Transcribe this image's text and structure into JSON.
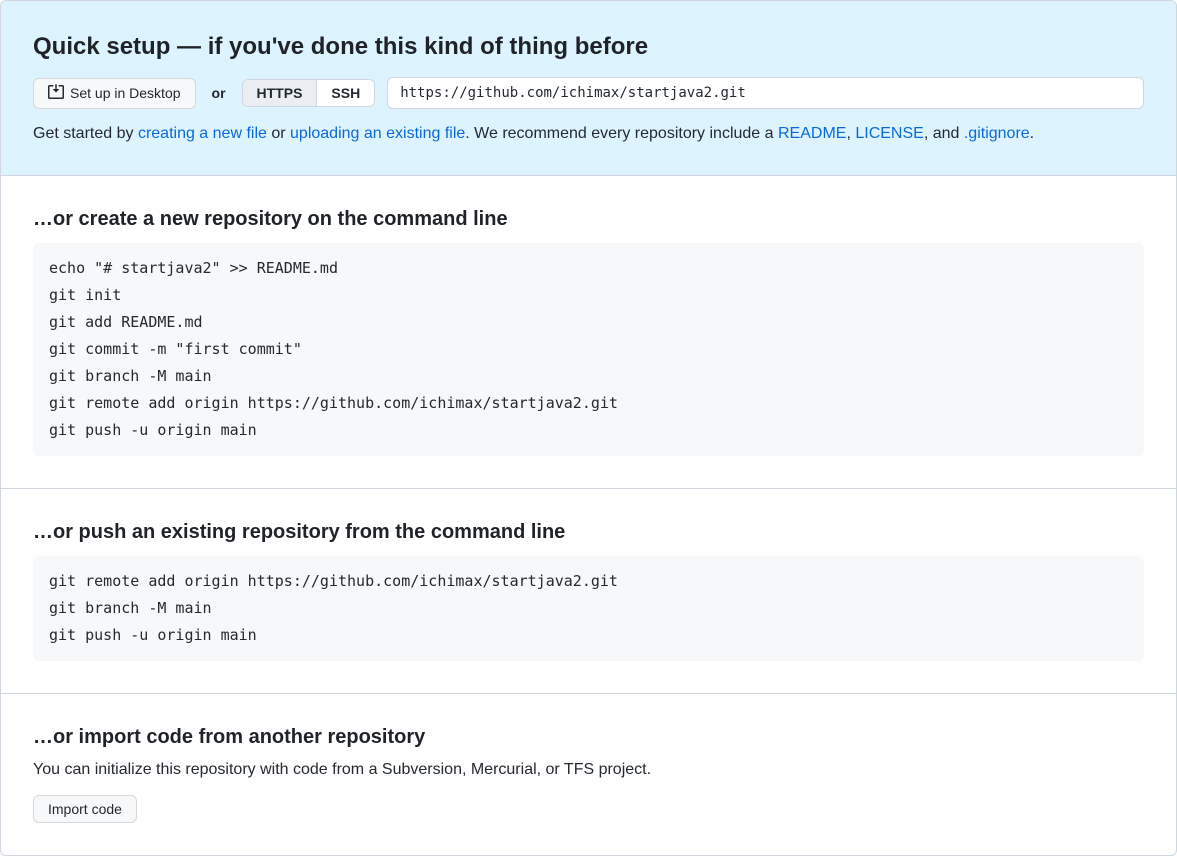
{
  "quickSetup": {
    "heading": "Quick setup — if you've done this kind of thing before",
    "desktopButton": "Set up in Desktop",
    "orLabel": "or",
    "tabs": {
      "https": "HTTPS",
      "ssh": "SSH"
    },
    "cloneUrl": "https://github.com/ichimax/startjava2.git",
    "help": {
      "prefix": "Get started by ",
      "createLink": "creating a new file",
      "mid1": " or ",
      "uploadLink": "uploading an existing file",
      "mid2": ". We recommend every repository include a ",
      "readmeLink": "README",
      "comma": ", ",
      "licenseLink": "LICENSE",
      "andText": ", and ",
      "gitignoreLink": ".gitignore",
      "period": "."
    }
  },
  "createSection": {
    "heading": "…or create a new repository on the command line",
    "code": "echo \"# startjava2\" >> README.md\ngit init\ngit add README.md\ngit commit -m \"first commit\"\ngit branch -M main\ngit remote add origin https://github.com/ichimax/startjava2.git\ngit push -u origin main"
  },
  "pushSection": {
    "heading": "…or push an existing repository from the command line",
    "code": "git remote add origin https://github.com/ichimax/startjava2.git\ngit branch -M main\ngit push -u origin main"
  },
  "importSection": {
    "heading": "…or import code from another repository",
    "description": "You can initialize this repository with code from a Subversion, Mercurial, or TFS project.",
    "button": "Import code"
  }
}
